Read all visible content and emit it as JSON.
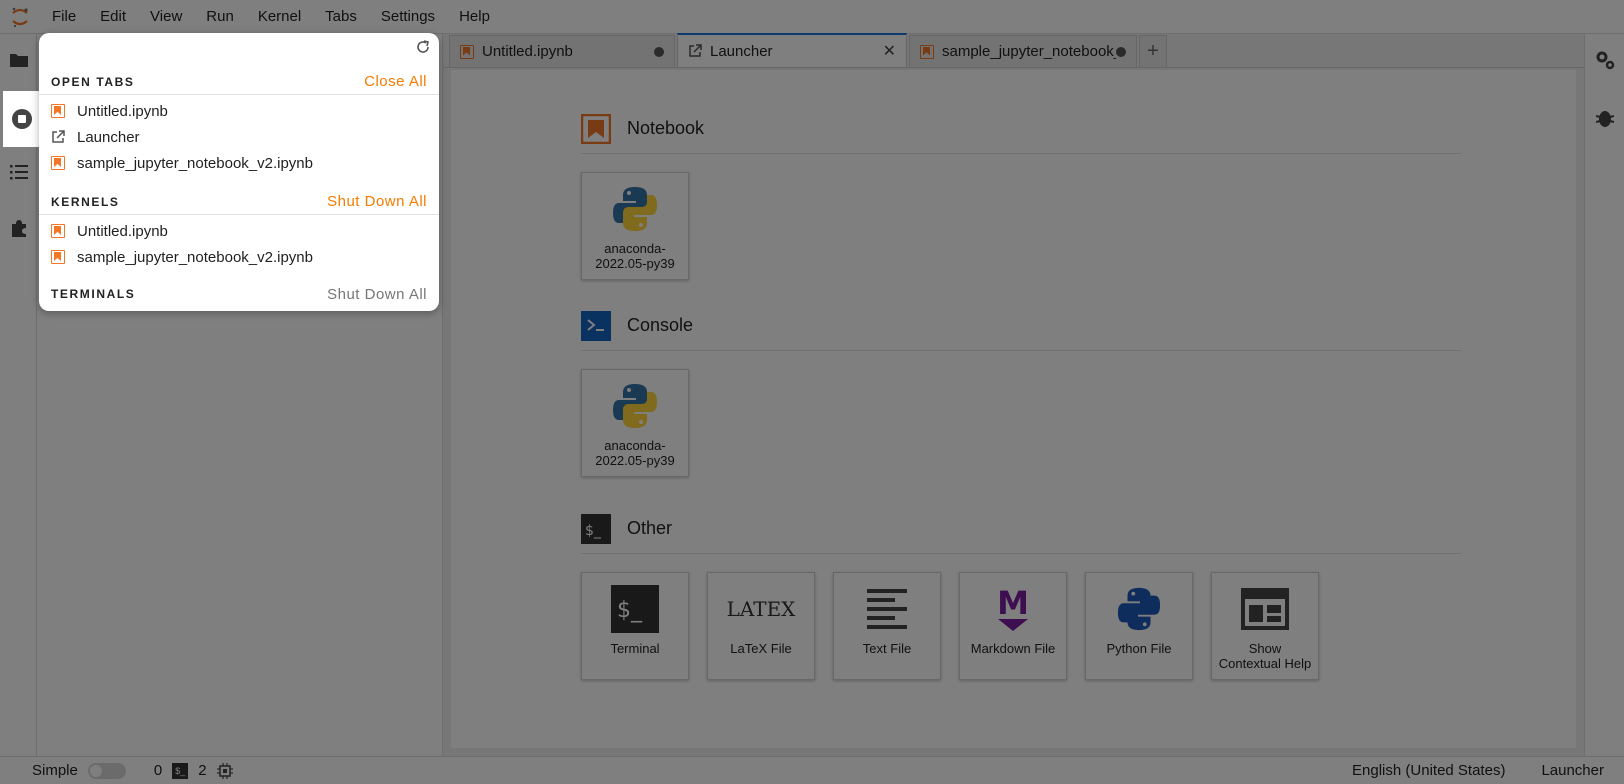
{
  "menubar": {
    "items": [
      "File",
      "Edit",
      "View",
      "Run",
      "Kernel",
      "Tabs",
      "Settings",
      "Help"
    ]
  },
  "tabs": [
    {
      "label": "Untitled.ipynb",
      "icon": "notebook-icon",
      "dirty": true
    },
    {
      "label": "Launcher",
      "icon": "launcher-icon",
      "active": true
    },
    {
      "label": "sample_jupyter_notebook_",
      "icon": "notebook-icon",
      "dirty": true
    }
  ],
  "launcher": {
    "notebook": {
      "title": "Notebook",
      "cards": [
        {
          "label": "anaconda-\n2022.05-py39",
          "icon": "python-icon"
        }
      ]
    },
    "console": {
      "title": "Console",
      "cards": [
        {
          "label": "anaconda-\n2022.05-py39",
          "icon": "python-icon"
        }
      ]
    },
    "other": {
      "title": "Other",
      "cards": [
        {
          "label": "Terminal",
          "icon": "terminal-icon"
        },
        {
          "label": "LaTeX File",
          "icon": "latex-icon",
          "glyph": "LATEX"
        },
        {
          "label": "Text File",
          "icon": "text-file-icon"
        },
        {
          "label": "Markdown File",
          "icon": "markdown-icon",
          "glyph": "M"
        },
        {
          "label": "Python File",
          "icon": "python-icon"
        },
        {
          "label": "Show\nContextual Help",
          "icon": "contextual-help-icon"
        }
      ]
    }
  },
  "running_panel": {
    "open_tabs": {
      "title": "OPEN TABS",
      "action": "Close All",
      "items": [
        "Untitled.ipynb",
        "Launcher",
        "sample_jupyter_notebook_v2.ipynb"
      ]
    },
    "kernels": {
      "title": "KERNELS",
      "action": "Shut Down All",
      "items": [
        "Untitled.ipynb",
        "sample_jupyter_notebook_v2.ipynb"
      ]
    },
    "terminals": {
      "title": "TERMINALS",
      "action": "Shut Down All"
    }
  },
  "statusbar": {
    "mode_label": "Simple",
    "terminals_count": "0",
    "kernels_count": "2",
    "language": "English (United States)",
    "active_doc": "Launcher"
  },
  "colors": {
    "accent_orange": "#f37726",
    "action_orange": "#f57c00",
    "active_tab_border": "#1976d2",
    "console_blue": "#1565c0",
    "markdown_purple": "#7b1fa2",
    "python_blue": "#3572A5",
    "python_yellow": "#FFD43B"
  }
}
